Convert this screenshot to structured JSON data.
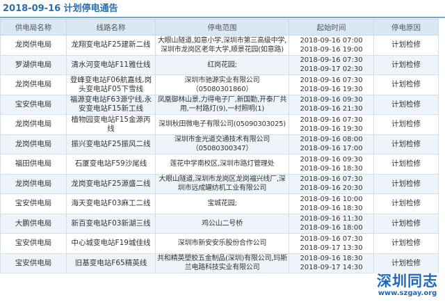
{
  "title": "2018-09-16  计划停电通告",
  "columns": [
    "供电局名称",
    "线路名称",
    "停电范围",
    "起始时间",
    "停电原因"
  ],
  "rows": [
    {
      "bureau": "龙岗供电局",
      "line": "龙翔变电站F25建新二线",
      "scope": "大眼山隧道,如意小学,深圳市第三高级中学,深圳市龙岗区老年大学,顺景花园(如意路)",
      "start": "2018-09-16 07:00",
      "end": "2018-09-16 19:00",
      "reason": "计划检修"
    },
    {
      "bureau": "罗湖供电局",
      "line": "清水河变电站F11雅仕线",
      "scope": "红岗花园;",
      "start": "2018-09-16 07:30",
      "end": "2018-09-17 02:30",
      "reason": "计划检修"
    },
    {
      "bureau": "龙岗供电局",
      "line": "登峰变电站F06航嘉线,岗头变电站F05下雪线",
      "scope": "深圳市驰源实业有限公司（05080301860）",
      "start": "2018-09-16 07:30",
      "end": "2018-09-16 19:30",
      "reason": "计划检修"
    },
    {
      "bureau": "宝安供电局",
      "line": "福源变电站F63源宁线,永安变电站F15新工线",
      "scope": "凤凰御林山景,力得电子厂,新国勤,开泰厂共用,一村路灯(9),一村照明(1)",
      "start": "2018-09-16 09:30",
      "end": "2018-09-16 21:30",
      "reason": "计划检修"
    },
    {
      "bureau": "龙岗供电局",
      "line": "植物园变电站F15金源丙线",
      "scope": "深圳秋田微电子有限公司(05090303025)",
      "start": "2018-09-16 07:30",
      "end": "2018-09-16 19:30",
      "reason": "计划检修"
    },
    {
      "bureau": "龙岗供电局",
      "line": "振兴变电站F25振风二线",
      "scope": "深圳市金光道交通技术有限公司（05080300347）",
      "start": "2018-09-16 08:00",
      "end": "2018-09-16 17:00",
      "reason": "计划检修"
    },
    {
      "bureau": "福田供电局",
      "line": "石厦变电站F59沙尾线",
      "scope": "莲花中学南校区,深圳市路灯管理处",
      "start": "2018-09-16 09:30",
      "end": "2018-09-16 18:30",
      "reason": "计划检修"
    },
    {
      "bureau": "龙岗供电局",
      "line": "龙岗变电站F25源盛二线",
      "scope": "大眼山隧道,深圳市龙岗区龙岗福兴线厂,深圳市远成罐纺机工业有限公司",
      "start": "2018-09-16 07:30",
      "end": "2018-09-16 20:30",
      "reason": "计划检修"
    },
    {
      "bureau": "宝安供电局",
      "line": "海天变电站F03麻工二线",
      "scope": "宝城花园;",
      "start": "2018-09-16 10:00",
      "end": "2018-09-16 18:30",
      "reason": "计划检修"
    },
    {
      "bureau": "大鹏供电局",
      "line": "新百变电站F03新湖三线",
      "scope": "鸡公山二号桥",
      "start": "2018-09-16 11:30",
      "end": "2018-09-16 18:00",
      "reason": "计划检修"
    },
    {
      "bureau": "宝安供电局",
      "line": "中心城变电站F19城佳线",
      "scope": "深圳市新安安乐股份合作公司",
      "start": "2018-09-16 07:30",
      "end": "2018-09-17 13:30",
      "reason": "计划检修"
    },
    {
      "bureau": "宝安供电局",
      "line": "旧基变电站F65精英线",
      "scope": "共和精英塑胶五金制品(深圳)有限公司,玛斯兰电路科技实业有限公司",
      "start": "2018-09-16 18:30",
      "end": "2018-09-17 14:30",
      "reason": "计划检修"
    }
  ],
  "watermark": {
    "logo": "深圳同志",
    "url": "www.szgay.org"
  }
}
